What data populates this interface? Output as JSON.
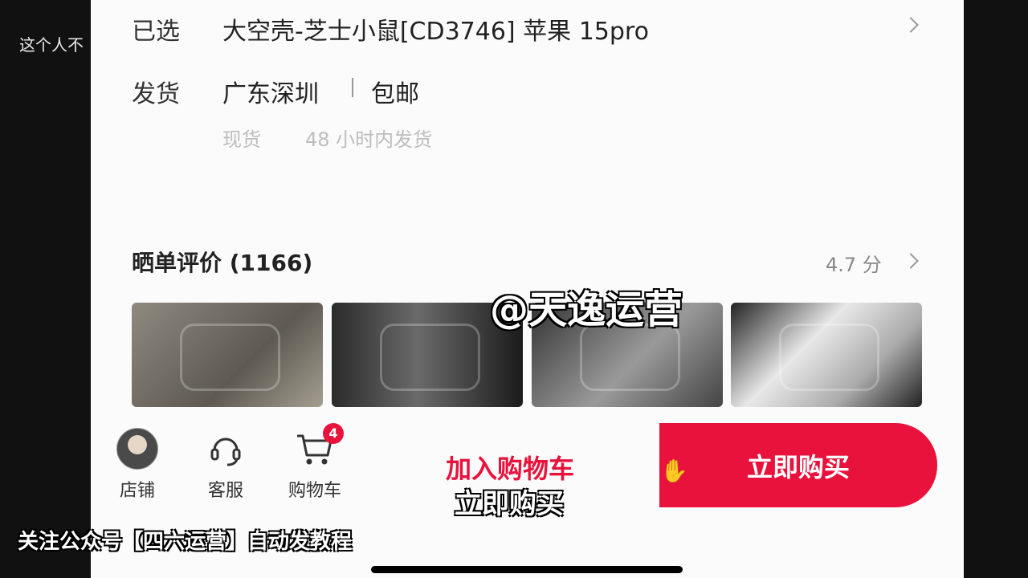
{
  "side_caption": "这个人不",
  "selected": {
    "label": "已选",
    "value": "大空壳-芝士小鼠[CD3746] 苹果 15pro"
  },
  "shipping": {
    "label": "发货",
    "origin": "广东深圳",
    "fee": "包邮",
    "stock": "现货",
    "dispatch": "48 小时内发货"
  },
  "reviews": {
    "title": "晒单评价 (1166)",
    "rating": "4.7 分"
  },
  "watermark": "@天逸运营",
  "bottom_nav": {
    "store_label": "店铺",
    "service_label": "客服",
    "cart_label": "购物车",
    "cart_badge": "4"
  },
  "actions": {
    "add_to_cart": "加入购物车",
    "buy_now": "立即购买"
  },
  "subtitle": "立即购买",
  "promo": "关注公众号【四六运营】自动发教程",
  "colors": {
    "accent": "#e8123c",
    "panel_bg": "#fbfbfb",
    "frame_bg": "#111111"
  }
}
